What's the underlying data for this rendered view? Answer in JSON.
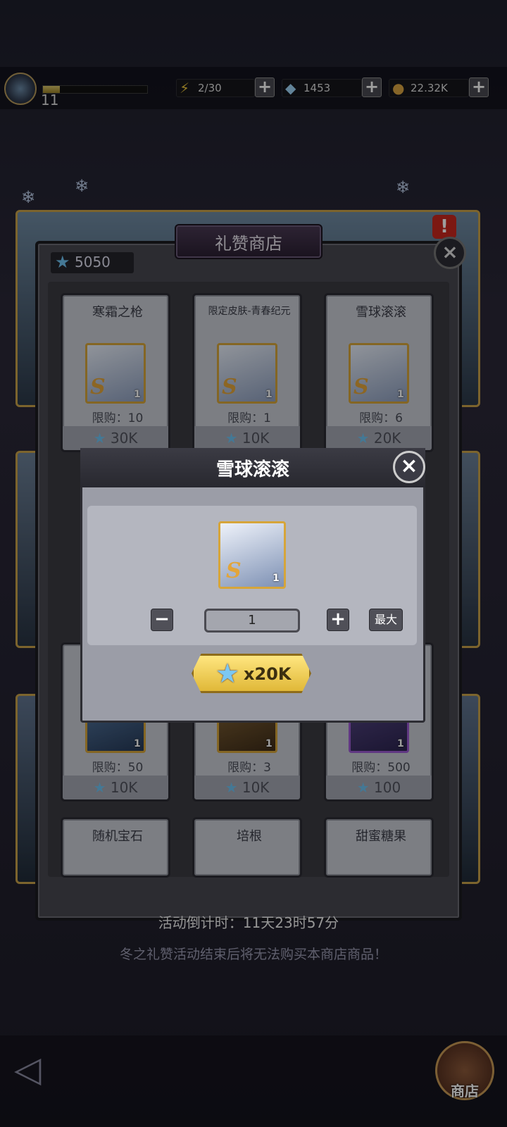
{
  "topbar": {
    "level": "11",
    "xp_fraction": 0.16,
    "stamina": "2/30",
    "diamonds": "1453",
    "coins": "22.32K",
    "icons": [
      "lightning-icon",
      "diamond-icon",
      "coin-icon",
      "plus-icon"
    ]
  },
  "shop": {
    "title": "礼赞商店",
    "currency": "5050",
    "items": [
      {
        "name": "寒霜之枪",
        "limit": "限购：10",
        "price": "30K",
        "qty": "1"
      },
      {
        "name": "限定皮肤-青春纪元",
        "limit": "限购：1",
        "price": "10K",
        "qty": "1"
      },
      {
        "name": "雪球滚滚",
        "limit": "限购：6",
        "price": "20K",
        "qty": "1"
      },
      {
        "name": "",
        "limit": "限购：50",
        "price": "10K",
        "qty": "1"
      },
      {
        "name": "",
        "limit": "限购：3",
        "price": "10K",
        "qty": "1"
      },
      {
        "name": "",
        "limit": "限购：500",
        "price": "100",
        "qty": "1"
      },
      {
        "name": "随机宝石",
        "limit": "",
        "price": "",
        "qty": ""
      },
      {
        "name": "培根",
        "limit": "",
        "price": "",
        "qty": ""
      },
      {
        "name": "甜蜜糖果",
        "limit": "",
        "price": "",
        "qty": ""
      }
    ],
    "countdown": "活动倒计时：11天23时57分",
    "notice": "冬之礼赞活动结束后将无法购买本商店商品！"
  },
  "modal": {
    "title": "雪球滚滚",
    "item_qty": "1",
    "minus": "−",
    "plus": "+",
    "quantity": "1",
    "max_label": "最大",
    "buy_label": "x20K"
  },
  "nav": {
    "store_label": "商店"
  },
  "colors": {
    "accent_gold": "#d6a53a",
    "star_blue": "#6fc2f0",
    "alert_red": "#c8281e"
  }
}
